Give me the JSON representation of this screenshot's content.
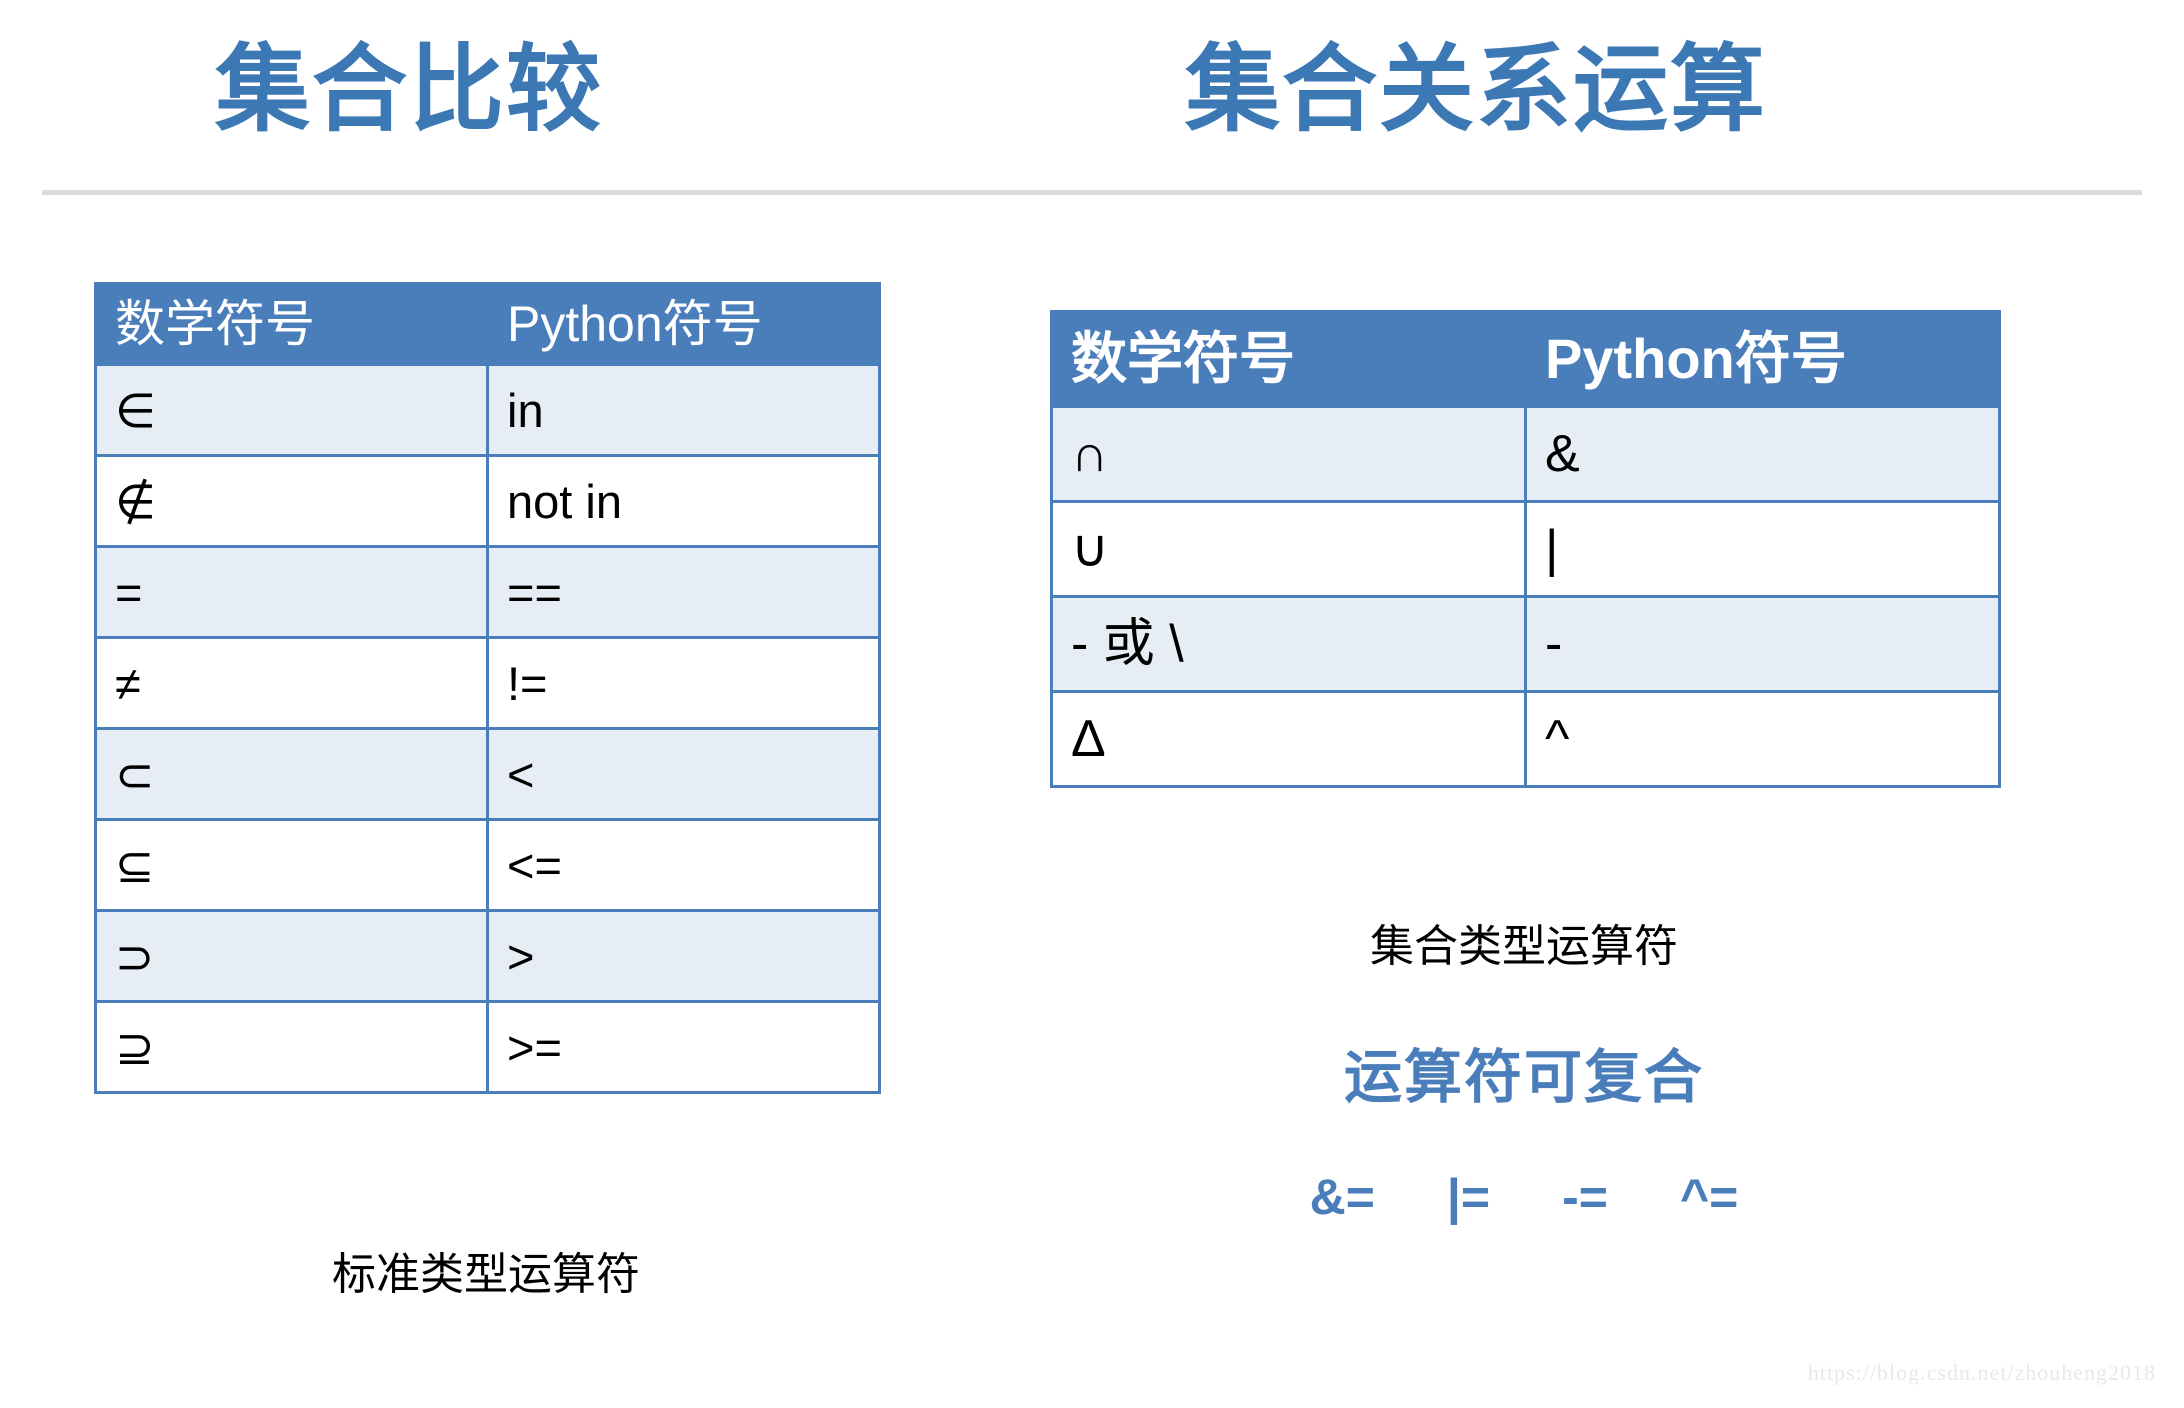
{
  "slide": {
    "left_panel": {
      "title": "集合比较",
      "caption": "标准类型运算符",
      "table": {
        "headers": [
          "数学符号",
          "Python符号"
        ],
        "rows": [
          [
            "∈",
            "in"
          ],
          [
            "∉",
            "not in"
          ],
          [
            "=",
            "=="
          ],
          [
            "≠",
            "!="
          ],
          [
            "⊂",
            "<"
          ],
          [
            "⊆",
            "<="
          ],
          [
            "⊃",
            ">"
          ],
          [
            "⊇",
            ">="
          ]
        ]
      }
    },
    "right_panel": {
      "title": "集合关系运算",
      "caption": "集合类型运算符",
      "compound_heading": "运算符可复合",
      "compound_ops": [
        "&=",
        "|=",
        "-=",
        "^="
      ],
      "table": {
        "headers": [
          "数学符号",
          "Python符号"
        ],
        "rows": [
          [
            "∩",
            "&"
          ],
          [
            "∪",
            "|"
          ],
          [
            "- 或 \\",
            "-"
          ],
          [
            "Δ",
            "^"
          ]
        ]
      }
    },
    "watermark": "https://blog.csdn.net/zhouheng2018",
    "colors": {
      "accent_blue": "#4A7EBB",
      "title_blue": "#3C78B4",
      "row_alt": "#E7EDF5",
      "rule_gray": "#DCDCDC"
    }
  }
}
